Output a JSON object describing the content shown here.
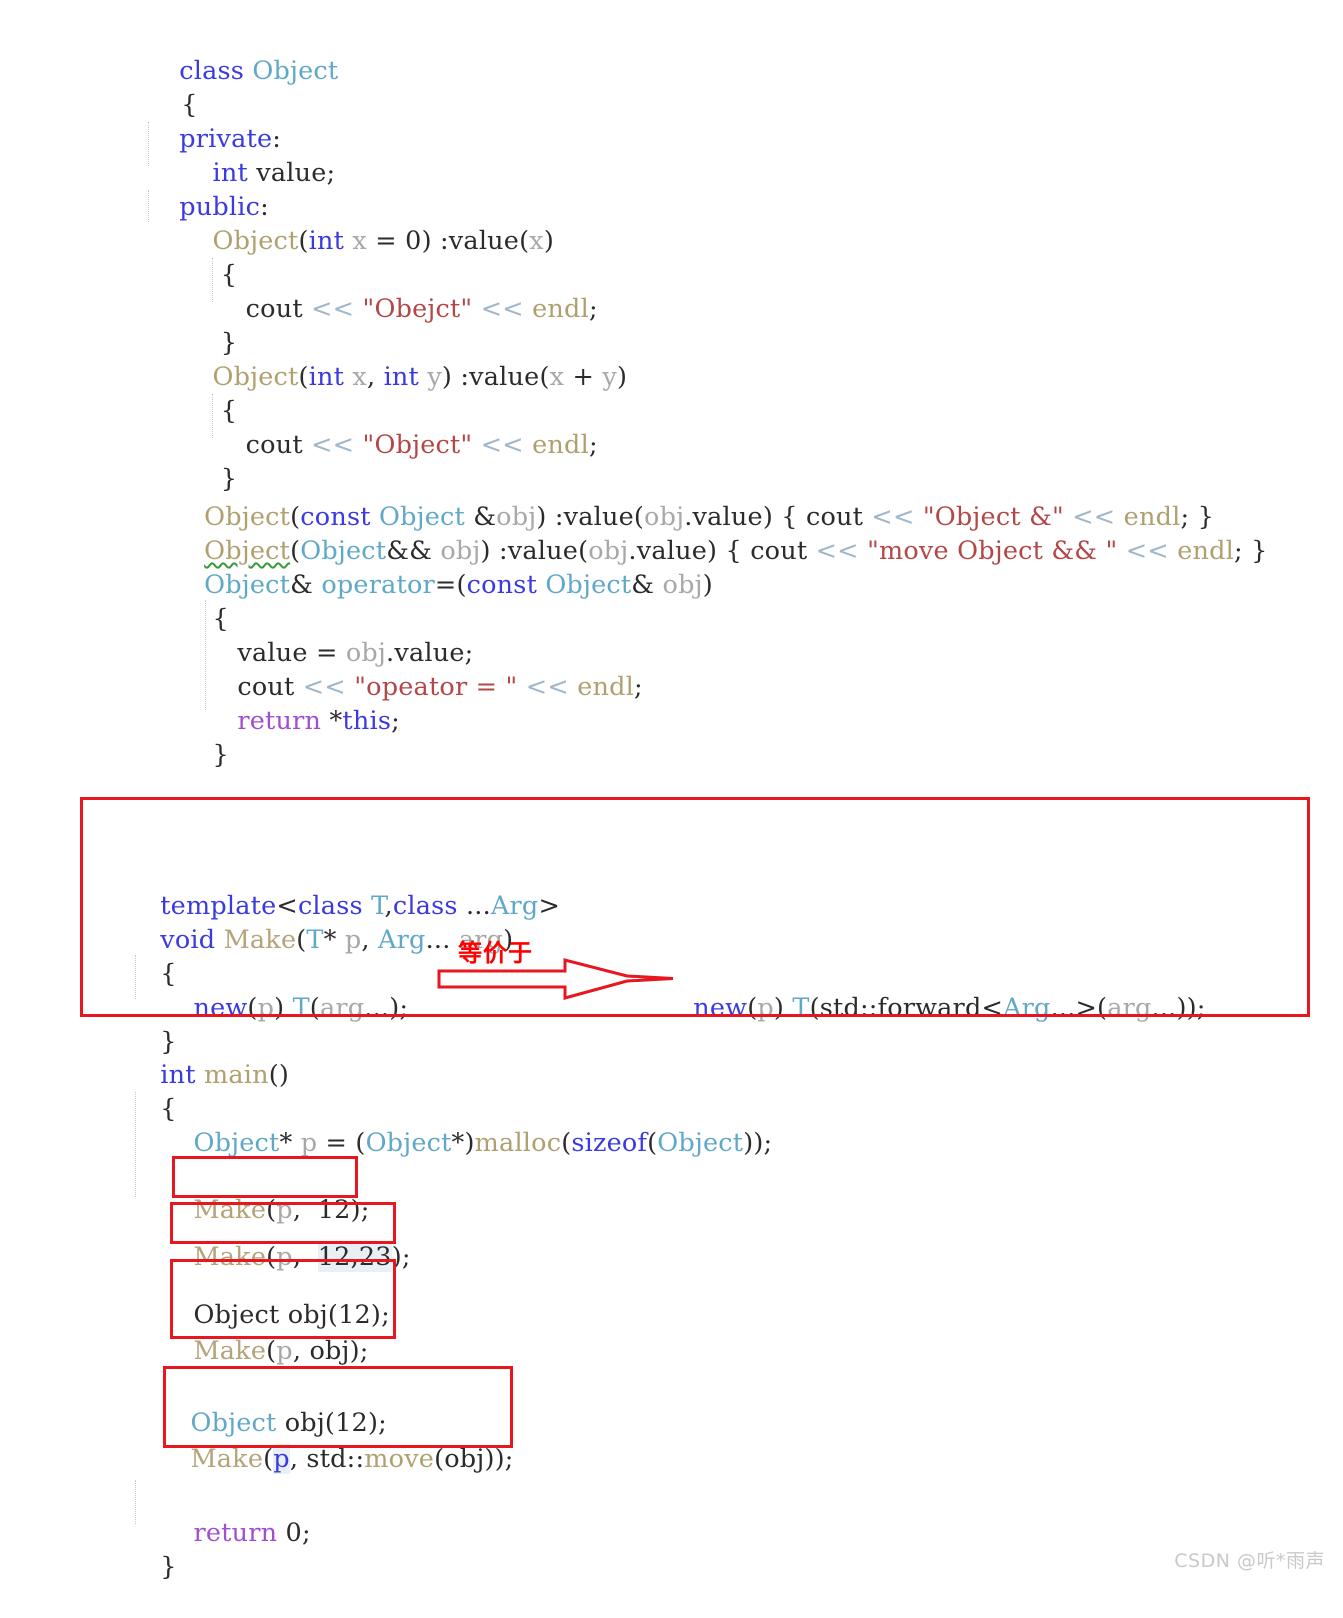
{
  "document": {
    "kind": "cpp-source-screenshot",
    "language": "C++"
  },
  "code": {
    "class_block": [
      {
        "id": "l01",
        "text": "class Object"
      },
      {
        "id": "l02",
        "text": "{"
      },
      {
        "id": "l03",
        "text": "private:"
      },
      {
        "id": "l04",
        "text": "    int value;"
      },
      {
        "id": "l05",
        "text": "public:"
      },
      {
        "id": "l06",
        "text": "    Object(int x = 0) :value(x)"
      },
      {
        "id": "l07",
        "text": "    {"
      },
      {
        "id": "l08",
        "text": "        cout << \"Obejct\" << endl;"
      },
      {
        "id": "l09",
        "text": "    }"
      },
      {
        "id": "l10",
        "text": "    Object(int x, int y) :value(x + y)"
      },
      {
        "id": "l11",
        "text": "    {"
      },
      {
        "id": "l12",
        "text": "        cout << \"Object\" << endl;"
      },
      {
        "id": "l13",
        "text": "    }"
      },
      {
        "id": "l14",
        "text": "    Object(const Object &obj) :value(obj.value) { cout << \"Object &\" << endl; }"
      },
      {
        "id": "l15",
        "text": "    Object(Object&& obj) :value(obj.value) { cout << \"move Object && \" << endl; }"
      },
      {
        "id": "l16",
        "text": "    Object& operator=(const Object& obj)"
      },
      {
        "id": "l17",
        "text": "    {"
      },
      {
        "id": "l18",
        "text": "        value = obj.value;"
      },
      {
        "id": "l19",
        "text": "        cout << \"opeator = \" << endl;"
      },
      {
        "id": "l20",
        "text": "        return *this;"
      },
      {
        "id": "l21",
        "text": "    }"
      }
    ],
    "template_block": [
      {
        "id": "t01",
        "text": "template<class T,class ...Arg>"
      },
      {
        "id": "t02",
        "text": "void Make(T* p, Arg... arg)"
      },
      {
        "id": "t03",
        "text": "{"
      },
      {
        "id": "t04",
        "text": "    new(p) T(arg...);"
      },
      {
        "id": "t05",
        "text": "}"
      }
    ],
    "equivalent_expression": "new(p) T(std::forward<Arg...>(arg...));",
    "main_block": [
      {
        "id": "m01",
        "text": "int main()"
      },
      {
        "id": "m02",
        "text": "{"
      },
      {
        "id": "m03",
        "text": "    Object* p = (Object*)malloc(sizeof(Object));"
      },
      {
        "id": "m04",
        "text": "    Make(p, 12);"
      },
      {
        "id": "m05",
        "text": "    Make(p, 12, 23);"
      },
      {
        "id": "m06",
        "text": "    Object obj(12);"
      },
      {
        "id": "m07",
        "text": "    Make(p, obj);"
      },
      {
        "id": "m08",
        "text": "    Object obj(12);"
      },
      {
        "id": "m09",
        "text": "    Make(p, std::move(obj));"
      },
      {
        "id": "m10",
        "text": "    return 0;"
      },
      {
        "id": "m11",
        "text": "}"
      }
    ]
  },
  "annotations": {
    "equiv_label": "等价于",
    "equiv_label_meaning": "equivalent to",
    "boxes": [
      {
        "name": "template-make-box",
        "label": "template Make function"
      },
      {
        "name": "make-12-box",
        "label": "Make(p, 12);"
      },
      {
        "name": "make-12-23-box",
        "label": "Make(p, 12, 23);"
      },
      {
        "name": "make-lvalue-obj-box",
        "label": "Object obj(12); Make(p, obj);"
      },
      {
        "name": "make-rvalue-move-box",
        "label": "Object obj(12); Make(p, std::move(obj));"
      }
    ]
  },
  "colors": {
    "accent_red": "#e8161f",
    "keyword_blue": "#3a3ae0",
    "type_teal": "#5fa8c8",
    "type_olive": "#b0a070",
    "string_red": "#b34747",
    "return_purple": "#a14fd0",
    "stream_op": "#9fb7c9",
    "squiggle_green": "#3a9a3a",
    "watermark_grey": "#c9c9c9"
  },
  "watermark": {
    "text": "CSDN @听*雨声"
  }
}
